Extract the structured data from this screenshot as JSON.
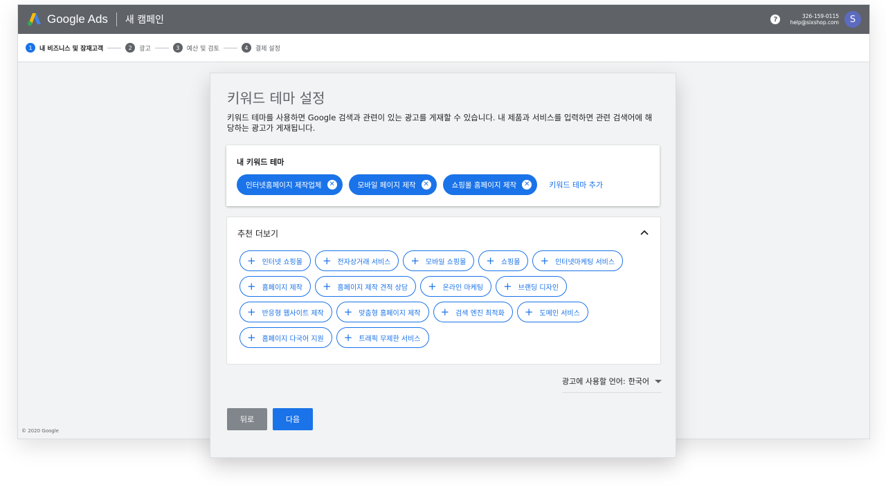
{
  "header": {
    "brand": "Google Ads",
    "campaign": "새 캠페인",
    "phone": "326-159-0115",
    "email": "help@sixshop.com",
    "avatar_letter": "S"
  },
  "steps": [
    {
      "num": "1",
      "label": "내 비즈니스 및 잠재고객",
      "active": true
    },
    {
      "num": "2",
      "label": "광고",
      "active": false
    },
    {
      "num": "3",
      "label": "예산 및 검토",
      "active": false
    },
    {
      "num": "4",
      "label": "결제 설정",
      "active": false
    }
  ],
  "card": {
    "title": "키워드 테마 설정",
    "description": "키워드 테마를 사용하면 Google 검색과 관련이 있는 광고를 게재할 수 있습니다. 내 제품과 서비스를 입력하면 관련 검색어에 해당하는 광고가 게재됩니다."
  },
  "my_keywords": {
    "title": "내 키워드 테마",
    "chips": [
      "인터넷홈페이지 제작업체",
      "모바일 페이지 제작",
      "쇼핑몰 홈페이지 제작"
    ],
    "add_label": "키워드 테마 추가"
  },
  "recommendations": {
    "title": "추천 더보기",
    "chips": [
      "인터넷 쇼핑몰",
      "전자상거래 서비스",
      "모바일 쇼핑몰",
      "쇼핑몰",
      "인터넷마케팅 서비스",
      "홈페이지 제작",
      "홈페이지 제작 견적 상담",
      "온라인 마케팅",
      "브랜딩 디자인",
      "반응형 웹사이트 제작",
      "맞춤형 홈페이지 제작",
      "검색 엔진 최적화",
      "도메인 서비스",
      "홈페이지 다국어 지원",
      "트래픽 무제한 서비스"
    ]
  },
  "language": {
    "label": "광고에 사용할 언어:",
    "value": "한국어"
  },
  "buttons": {
    "back": "뒤로",
    "next": "다음"
  },
  "footer": "© 2020 Google",
  "colors": {
    "accent": "#1a73e8",
    "header": "#5f6368"
  }
}
